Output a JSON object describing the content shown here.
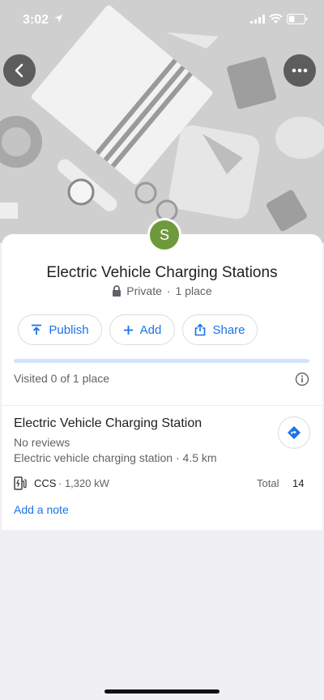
{
  "status_bar": {
    "time": "3:02"
  },
  "list": {
    "avatar_letter": "S",
    "title": "Electric Vehicle Charging Stations",
    "visibility": "Private",
    "place_count": "1 place",
    "separator": "·"
  },
  "actions": {
    "publish": "Publish",
    "add": "Add",
    "share": "Share"
  },
  "progress": {
    "visited_text": "Visited 0 of 1 place",
    "visited_fraction": 0
  },
  "place": {
    "name": "Electric Vehicle Charging Station",
    "reviews": "No reviews",
    "type_distance": "Electric vehicle charging station · 4.5 km",
    "connector": "CCS",
    "power": "· 1,320 kW",
    "total_label": "Total",
    "total_value": "14",
    "add_note": "Add a note"
  },
  "colors": {
    "accent": "#1a73e8",
    "avatar": "#6f9a3c",
    "progress_track": "#d2e3fc"
  },
  "icons": [
    "back-arrow-icon",
    "more-icon",
    "lock-icon",
    "publish-icon",
    "plus-icon",
    "share-icon",
    "info-icon",
    "directions-icon",
    "ev-charger-icon"
  ]
}
